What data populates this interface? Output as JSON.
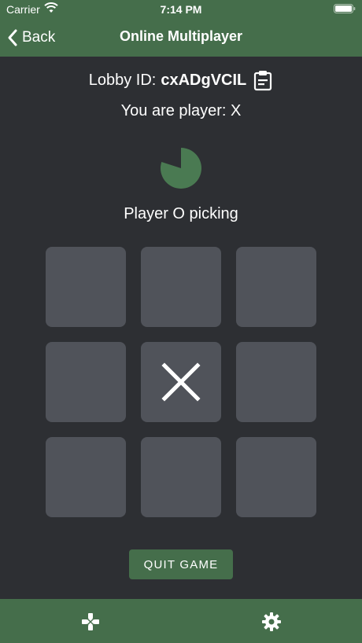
{
  "status_bar": {
    "carrier": "Carrier",
    "time": "7:14 PM"
  },
  "nav": {
    "back_label": "Back",
    "title": "Online Multiplayer"
  },
  "lobby": {
    "label": "Lobby ID:",
    "id": "cxADgVCIL",
    "copy_icon": "clipboard-icon"
  },
  "player": {
    "text": "You are player: X"
  },
  "timer": {
    "icon": "pie-timer-icon",
    "remaining_fraction": 0.8
  },
  "turn_status": "Player O picking",
  "board": {
    "cells": [
      "",
      "",
      "",
      "",
      "X",
      "",
      "",
      "",
      ""
    ]
  },
  "quit_button": "QUIT GAME",
  "tab_bar": {
    "items": [
      {
        "icon": "gamepad-icon",
        "name": "games"
      },
      {
        "icon": "gear-icon",
        "name": "settings"
      }
    ]
  },
  "colors": {
    "accent": "#456e4b",
    "background": "#2d2f33",
    "cell": "#50535a",
    "timer": "#4a7a52"
  }
}
